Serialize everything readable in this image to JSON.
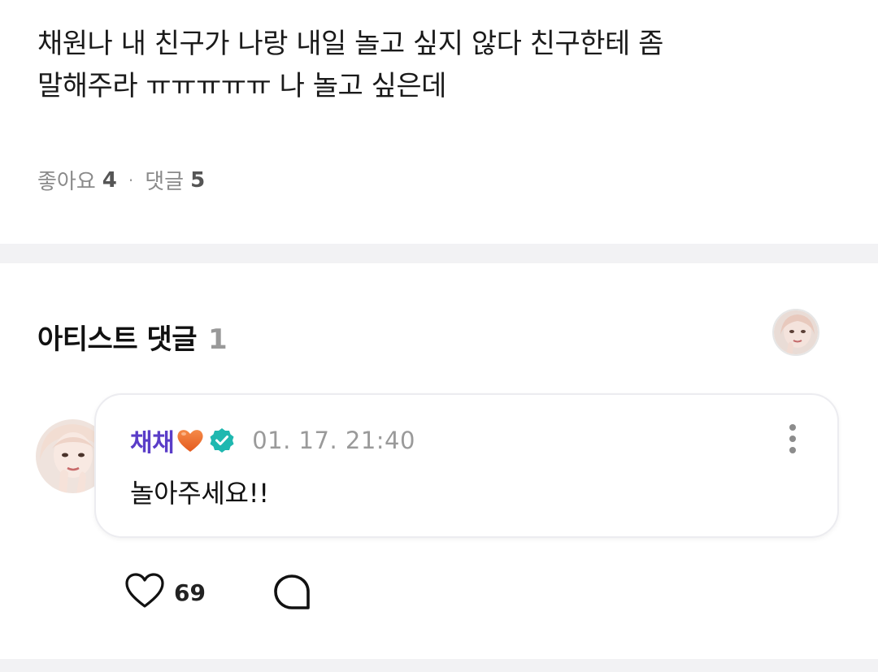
{
  "post": {
    "text_line1": "채원나 내 친구가 나랑 내일 놀고 싶지 않다 친구한테 좀",
    "text_line2": "말해주라 ㅠㅠㅠㅠㅠ 나 놀고 싶은데",
    "likes_label": "좋아요",
    "likes_count": "4",
    "separator": "·",
    "comments_label": "댓글",
    "comments_count": "5"
  },
  "artist_comments": {
    "title": "아티스트 댓글",
    "count": "1",
    "comment": {
      "author": "채채",
      "author_emoji": "orange-heart-icon",
      "verified_icon": "verified-badge-icon",
      "timestamp": "01. 17. 21:40",
      "body": "놀아주세요!!",
      "like_count": "69"
    }
  },
  "colors": {
    "author": "#5a3dc8",
    "verified": "#1fb8b0",
    "heart": "#ef6a2a",
    "divider": "#f2f2f4"
  }
}
